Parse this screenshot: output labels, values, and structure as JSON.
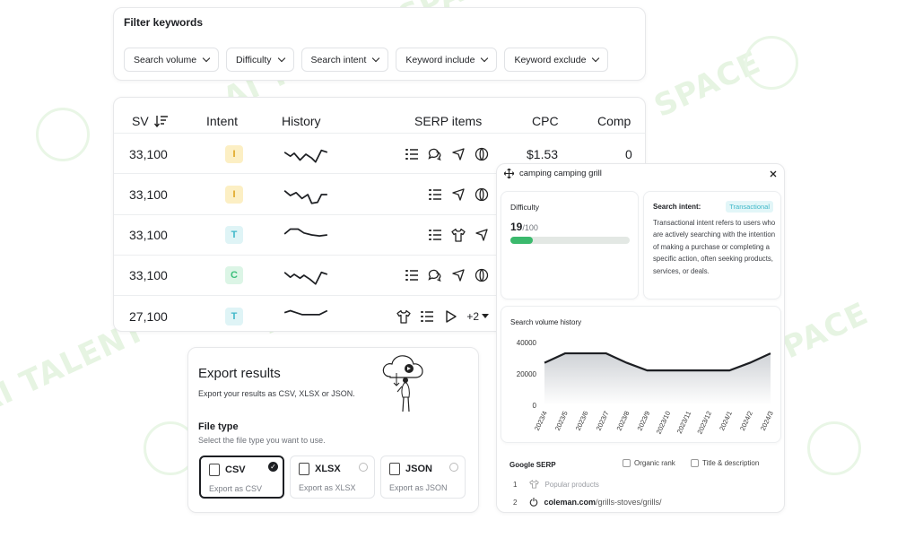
{
  "watermark": {
    "text": "AI TALENT SPACE"
  },
  "filter": {
    "title": "Filter keywords",
    "chips": [
      "Search volume",
      "Difficulty",
      "Search intent",
      "Keyword include",
      "Keyword exclude"
    ]
  },
  "table": {
    "headers": {
      "sv": "SV",
      "intent": "Intent",
      "history": "History",
      "serp": "SERP items",
      "cpc": "CPC",
      "comp": "Comp"
    },
    "rows": [
      {
        "sv": "33,100",
        "intent": "I",
        "cpc": "$1.53",
        "comp": "0",
        "serp": [
          "list-icon",
          "chat-icon",
          "share-icon",
          "globe-icon"
        ]
      },
      {
        "sv": "33,100",
        "intent": "I",
        "cpc": "",
        "comp": "",
        "serp": [
          "list-icon",
          "share-icon",
          "globe-icon"
        ]
      },
      {
        "sv": "33,100",
        "intent": "T",
        "cpc": "",
        "comp": "",
        "serp": [
          "list-icon",
          "shirt-icon",
          "share-icon"
        ]
      },
      {
        "sv": "33,100",
        "intent": "C",
        "cpc": "",
        "comp": "",
        "serp": [
          "list-icon",
          "chat-icon",
          "share-icon",
          "globe-icon"
        ]
      },
      {
        "sv": "27,100",
        "intent": "T",
        "cpc": "",
        "comp": "",
        "serp": [
          "shirt-icon",
          "list-icon",
          "play-icon"
        ],
        "more": "+2"
      }
    ],
    "intent_colors": {
      "I": {
        "bg": "#fcefc4",
        "fg": "#e0a521"
      },
      "T": {
        "bg": "#dff4f6",
        "fg": "#3fb8c9"
      },
      "C": {
        "bg": "#dcf5e6",
        "fg": "#3bbf7a"
      }
    }
  },
  "export": {
    "title": "Export results",
    "subtitle": "Export your results as CSV, XLSX or JSON.",
    "file_type_label": "File type",
    "file_type_hint": "Select the file type you want to use.",
    "options": [
      {
        "name": "CSV",
        "sub": "Export as CSV",
        "selected": true
      },
      {
        "name": "XLSX",
        "sub": "Export as XLSX",
        "selected": false
      },
      {
        "name": "JSON",
        "sub": "Export as JSON",
        "selected": false
      }
    ]
  },
  "detail": {
    "keyword": "camping camping grill",
    "difficulty_label": "Difficulty",
    "difficulty_value": "19",
    "difficulty_max": "/100",
    "difficulty_fraction": 0.19,
    "intent_label": "Search intent:",
    "intent_badge": "Transactional",
    "intent_text": "Transactional intent refers to users who are actively searching with the intention of making a purchase or completing a specific action, often seeking products, services, or deals.",
    "history_title": "Search volume history",
    "serp_title": "Google SERP",
    "serp_opt1": "Organic rank",
    "serp_opt2": "Title & description",
    "serp_results": [
      {
        "rank": "1",
        "text": "Popular products",
        "domain": "",
        "path": ""
      },
      {
        "rank": "2",
        "text": "",
        "domain": "coleman.com",
        "path": "/grills-stoves/grills/"
      }
    ]
  },
  "chart_data": {
    "type": "area",
    "x": [
      "2023/4",
      "2023/5",
      "2023/6",
      "2023/7",
      "2023/8",
      "2023/9",
      "2023/10",
      "2023/11",
      "2023/12",
      "2024/1",
      "2024/2",
      "2024/3"
    ],
    "values": [
      27100,
      33100,
      33100,
      33100,
      27100,
      22200,
      22200,
      22200,
      22200,
      22200,
      27100,
      33100
    ],
    "yticks": [
      "40000",
      "20000",
      "0"
    ],
    "ylim": [
      0,
      40000
    ]
  }
}
